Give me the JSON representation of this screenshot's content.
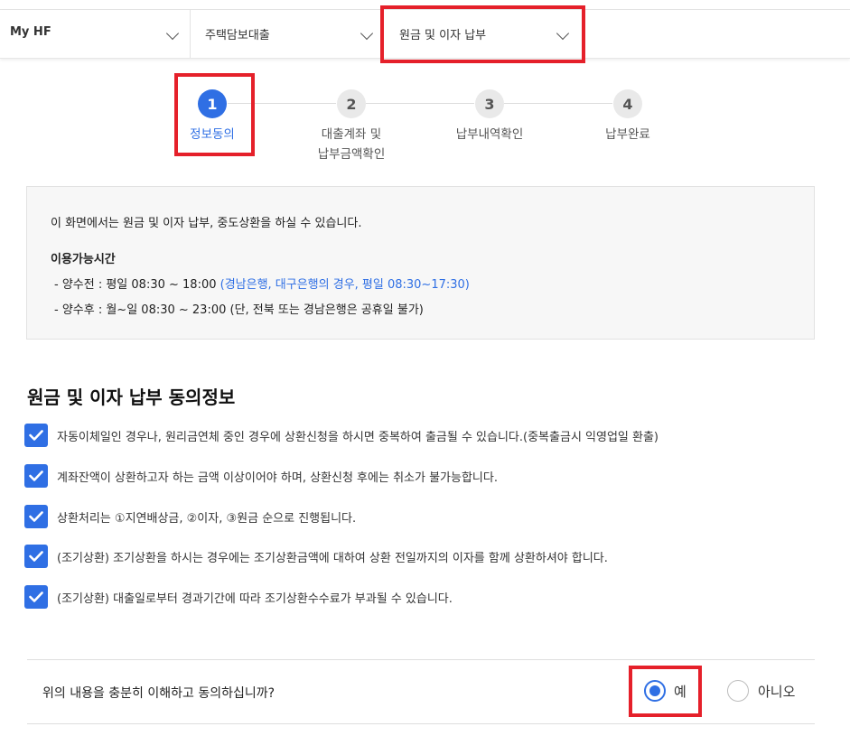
{
  "nav": {
    "items": [
      {
        "label": "My HF"
      },
      {
        "label": "주택담보대출"
      },
      {
        "label": "원금 및 이자 납부"
      }
    ]
  },
  "steps": [
    {
      "number": "1",
      "label": "정보동의",
      "active": true
    },
    {
      "number": "2",
      "label_line1": "대출계좌 및",
      "label_line2": "납부금액확인",
      "active": false
    },
    {
      "number": "3",
      "label": "납부내역확인",
      "active": false
    },
    {
      "number": "4",
      "label": "납부완료",
      "active": false
    }
  ],
  "info": {
    "intro": "이 화면에서는 원금 및 이자 납부, 중도상환을 하실 수 있습니다.",
    "hours_title": "이용가능시간",
    "line1_prefix": "-  양수전 : 평일 08:30 ~ 18:00 ",
    "line1_note": "(경남은행, 대구은행의 경우, 평일 08:30~17:30)",
    "line2": "-  양수후 : 월~일 08:30 ~ 23:00 (단, 전북 또는 경남은행은 공휴일 불가)"
  },
  "consent": {
    "title": "원금 및 이자 납부 동의정보",
    "items": [
      "자동이체일인 경우나, 원리금연체 중인 경우에 상환신청을 하시면 중복하여 출금될 수 있습니다.(중복출금시 익영업일 환출)",
      "계좌잔액이 상환하고자 하는 금액 이상이어야 하며, 상환신청 후에는 취소가 불가능합니다.",
      "상환처리는 ①지연배상금, ②이자, ③원금 순으로 진행됩니다.",
      "(조기상환) 조기상환을 하시는 경우에는 조기상환금액에 대하여 상환 전일까지의 이자를 함께 상환하셔야 합니다.",
      "(조기상환) 대출일로부터 경과기간에 따라 조기상환수수료가 부과될 수 있습니다."
    ],
    "question": "위의 내용을 충분히 이해하고 동의하십니까?",
    "yes_label": "예",
    "no_label": "아니오",
    "selected": "yes"
  },
  "colors": {
    "accent": "#2f6fe4",
    "highlight": "#e5202a"
  }
}
